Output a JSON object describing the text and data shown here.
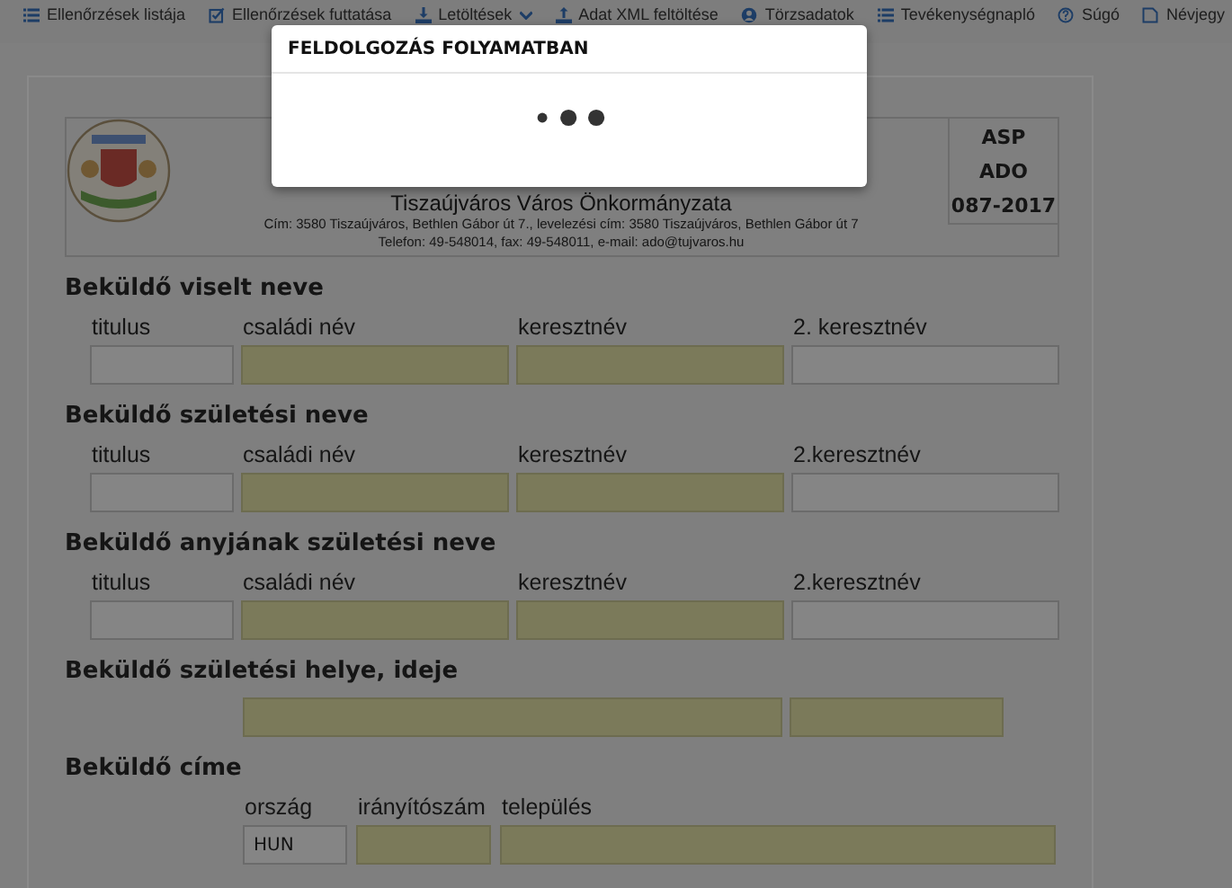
{
  "nav": [
    {
      "label": "Ellenőrzések listája",
      "kind": "list"
    },
    {
      "label": "Ellenőrzések futtatása",
      "kind": "check"
    },
    {
      "label": "Letöltések",
      "kind": "download",
      "dropdown": true
    },
    {
      "label": "Adat XML feltöltése",
      "kind": "upload"
    },
    {
      "label": "Törzsadatok",
      "kind": "user"
    },
    {
      "label": "Tevékenységnapló",
      "kind": "list"
    },
    {
      "label": "Súgó",
      "kind": "help"
    },
    {
      "label": "Névjegy",
      "kind": "doc"
    }
  ],
  "modal": {
    "title": "FELDOLGOZÁS FOLYAMATBAN"
  },
  "header": {
    "org": "Tiszaújváros Város Önkormányzata",
    "address": "Cím: 3580 Tiszaújváros, Bethlen Gábor út 7., levelezési cím: 3580 Tiszaújváros, Bethlen Gábor út 7",
    "contact": "Telefon: 49-548014, fax: 49-548011, e-mail: ado@tujvaros.hu",
    "code": [
      "ASP",
      "ADO",
      "087-2017"
    ]
  },
  "sections": [
    {
      "title": "Beküldő viselt neve",
      "kind": "name",
      "fields": [
        {
          "label": "titulus",
          "required": false
        },
        {
          "label": "családi név",
          "required": true
        },
        {
          "label": "keresztnév",
          "required": true
        },
        {
          "label": "2. keresztnév",
          "required": false
        }
      ]
    },
    {
      "title": "Beküldő születési neve",
      "kind": "name",
      "fields": [
        {
          "label": "titulus",
          "required": false
        },
        {
          "label": "családi név",
          "required": true
        },
        {
          "label": "keresztnév",
          "required": true
        },
        {
          "label": "2.keresztnév",
          "required": false
        }
      ]
    },
    {
      "title": "Beküldő anyjának születési neve",
      "kind": "name",
      "fields": [
        {
          "label": "titulus",
          "required": false
        },
        {
          "label": "családi név",
          "required": true
        },
        {
          "label": "keresztnév",
          "required": true
        },
        {
          "label": "2.keresztnév",
          "required": false
        }
      ]
    },
    {
      "title": "Beküldő születési helye, ideje",
      "kind": "birth",
      "fields": [
        {
          "required": true
        },
        {
          "required": true
        }
      ]
    },
    {
      "title": "Beküldő címe",
      "kind": "address",
      "fields": [
        {
          "label": "ország",
          "required": false,
          "value": "HUN"
        },
        {
          "label": "irányítószám",
          "required": true
        },
        {
          "label": "település",
          "required": true
        }
      ]
    }
  ]
}
